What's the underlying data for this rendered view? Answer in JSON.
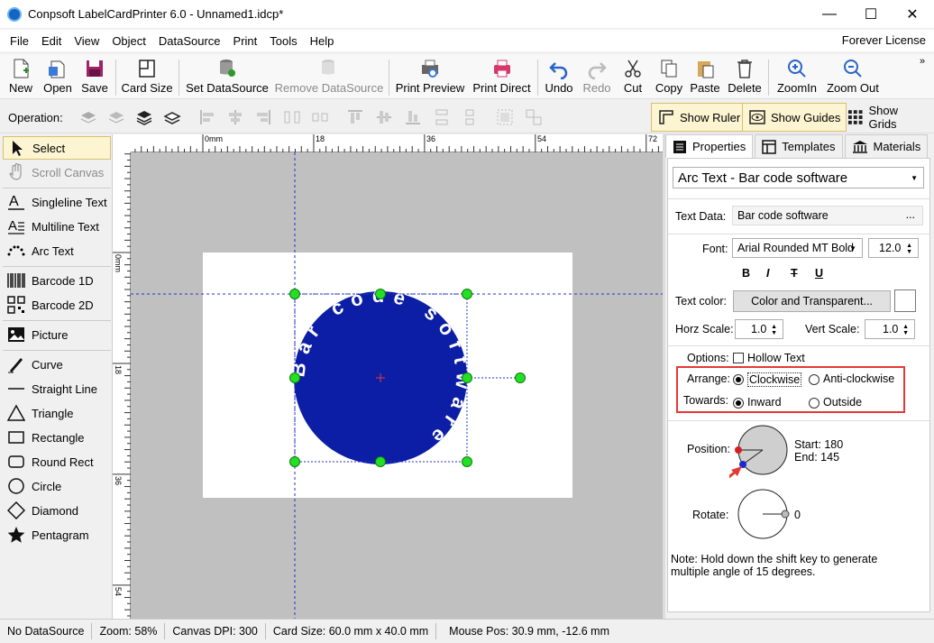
{
  "window": {
    "title": "Conpsoft LabelCardPrinter 6.0 - Unnamed1.idcp*",
    "minimize": "—",
    "maximize": "☐",
    "close": "✕"
  },
  "menu": {
    "items": [
      "File",
      "Edit",
      "View",
      "Object",
      "DataSource",
      "Print",
      "Tools",
      "Help"
    ],
    "license": "Forever License"
  },
  "toolbar": {
    "new": "New",
    "open": "Open",
    "save": "Save",
    "card_size": "Card Size",
    "set_datasource": "Set DataSource",
    "remove_datasource": "Remove DataSource",
    "print_preview": "Print Preview",
    "print_direct": "Print Direct",
    "undo": "Undo",
    "redo": "Redo",
    "cut": "Cut",
    "copy": "Copy",
    "paste": "Paste",
    "delete": "Delete",
    "zoom_in": "ZoomIn",
    "zoom_out": "Zoom Out",
    "more": "»"
  },
  "operation": {
    "label": "Operation:",
    "show_ruler": "Show Ruler",
    "show_guides": "Show Guides",
    "show_grids": "Show Grids"
  },
  "tools": {
    "select": "Select",
    "scroll_canvas": "Scroll Canvas",
    "singleline_text": "Singleline Text",
    "multiline_text": "Multiline Text",
    "arc_text": "Arc Text",
    "barcode_1d": "Barcode 1D",
    "barcode_2d": "Barcode 2D",
    "picture": "Picture",
    "curve": "Curve",
    "straight_line": "Straight Line",
    "triangle": "Triangle",
    "rectangle": "Rectangle",
    "round_rect": "Round Rect",
    "circle": "Circle",
    "diamond": "Diamond",
    "pentagram": "Pentagram"
  },
  "ruler": {
    "h_labels": [
      "0mm",
      "18",
      "36",
      "54",
      "72"
    ],
    "v_labels": [
      "0mm",
      "18",
      "36",
      "54"
    ]
  },
  "canvas": {
    "arc_text": "Bar code software",
    "arc_start_deg": 180,
    "arc_end_deg": 145
  },
  "panel": {
    "tabs": [
      "Properties",
      "Templates",
      "Materials"
    ],
    "object_select": "Arc Text - Bar code software",
    "text_data_label": "Text Data:",
    "text_data_value": "Bar code software",
    "ellipsis": "...",
    "font_label": "Font:",
    "font_value": "Arial Rounded MT Bold",
    "font_size": "12.0",
    "bold": "B",
    "italic": "I",
    "strike": "T",
    "underline": "U",
    "text_color_label": "Text color:",
    "color_button": "Color and Transparent...",
    "horz_scale_label": "Horz Scale:",
    "horz_scale_value": "1.0",
    "vert_scale_label": "Vert Scale:",
    "vert_scale_value": "1.0",
    "options_label": "Options:",
    "hollow_text": "Hollow Text",
    "arrange_label": "Arrange:",
    "clockwise": "Clockwise",
    "anti_clockwise": "Anti-clockwise",
    "towards_label": "Towards:",
    "inward": "Inward",
    "outside": "Outside",
    "position_label": "Position:",
    "start_text": "Start: 180",
    "end_text": "End: 145",
    "rotate_label": "Rotate:",
    "rotate_value": "0",
    "note": "Note: Hold down the shift key to generate multiple angle of 15 degrees."
  },
  "status": {
    "datasource": "No DataSource",
    "zoom": "Zoom: 58%",
    "dpi": "Canvas DPI: 300",
    "card_size": "Card Size: 60.0 mm x 40.0 mm",
    "mouse_pos": "Mouse Pos: 30.9 mm, -12.6 mm"
  },
  "colors": {
    "circle_fill": "#0d1ea6",
    "handle": "#22e022",
    "highlight_red": "#e53935",
    "selected_bg": "#fdf5d2"
  }
}
